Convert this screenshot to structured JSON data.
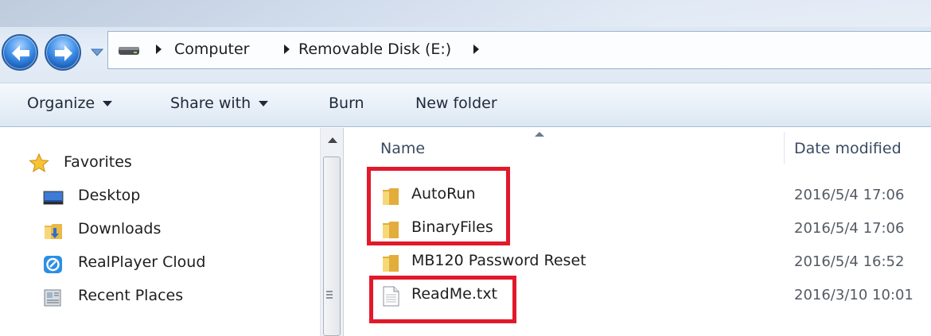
{
  "address_bar": {
    "crumbs": [
      "Computer",
      "Removable Disk (E:)"
    ]
  },
  "command_bar": {
    "organize": "Organize",
    "share_with": "Share with",
    "burn": "Burn",
    "new_folder": "New folder"
  },
  "nav_pane": {
    "favorites": "Favorites",
    "items": [
      {
        "label": "Desktop",
        "icon": "desktop-icon"
      },
      {
        "label": "Downloads",
        "icon": "downloads-folder-icon"
      },
      {
        "label": "RealPlayer Cloud",
        "icon": "realplayer-cloud-icon"
      },
      {
        "label": "Recent Places",
        "icon": "recent-places-icon"
      }
    ]
  },
  "file_list": {
    "columns": {
      "name": "Name",
      "date_modified": "Date modified"
    },
    "rows": [
      {
        "name": "AutoRun",
        "date": "2016/5/4 17:06",
        "type": "folder",
        "highlighted": true
      },
      {
        "name": "BinaryFiles",
        "date": "2016/5/4 17:06",
        "type": "folder",
        "highlighted": true
      },
      {
        "name": "MB120 Password Reset",
        "date": "2016/5/4 16:52",
        "type": "folder",
        "highlighted": false
      },
      {
        "name": "ReadMe.txt",
        "date": "2016/3/10 10:01",
        "type": "text-file",
        "highlighted": true
      }
    ]
  },
  "colors": {
    "highlight": "#e2192a",
    "nav_button": "#3f8fe8",
    "folder": "#f2c94c"
  }
}
